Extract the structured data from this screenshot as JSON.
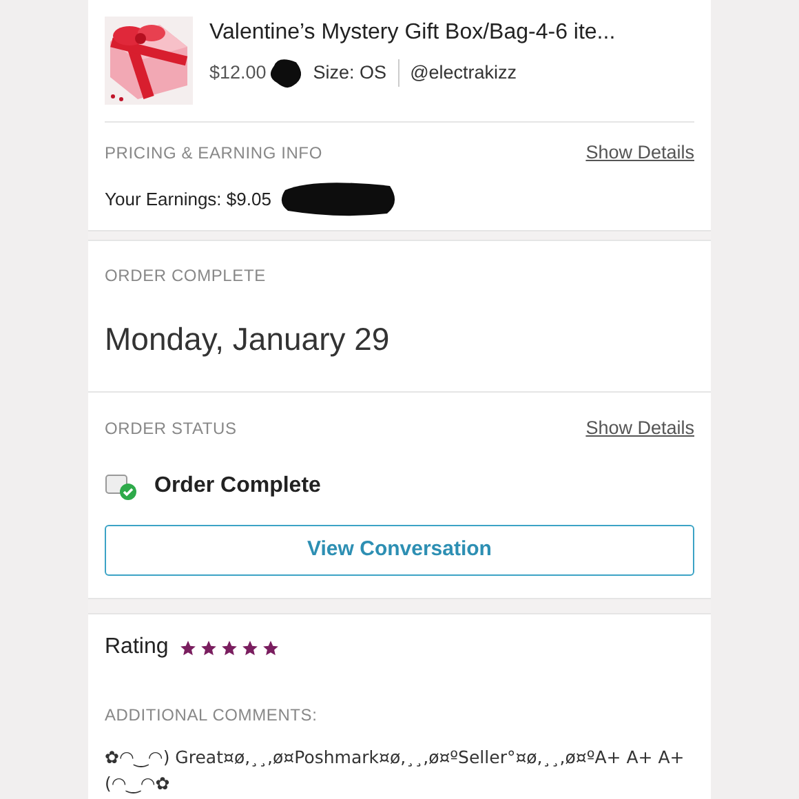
{
  "item": {
    "title": "Valentine’s Mystery Gift Box/Bag-4-6 ite...",
    "price": "$12.00",
    "size": "Size: OS",
    "seller": "@electrakizz"
  },
  "pricing": {
    "heading": "PRICING & EARNING INFO",
    "link": "Show Details",
    "earnings": "Your Earnings: $9.05"
  },
  "order_complete": {
    "heading": "ORDER COMPLETE",
    "date": "Monday, January 29"
  },
  "order_status": {
    "heading": "ORDER STATUS",
    "link": "Show Details",
    "status": "Order Complete",
    "button": "View Conversation"
  },
  "rating": {
    "label": "Rating",
    "stars": 5
  },
  "comments": {
    "heading": "ADDITIONAL COMMENTS:",
    "text": "✿◠‿◠) Great¤ø,¸¸,ø¤Poshmark¤ø,¸¸,ø¤ºSeller°¤ø,¸¸,ø¤ºA+ A+ A+ (◠‿◠✿"
  }
}
